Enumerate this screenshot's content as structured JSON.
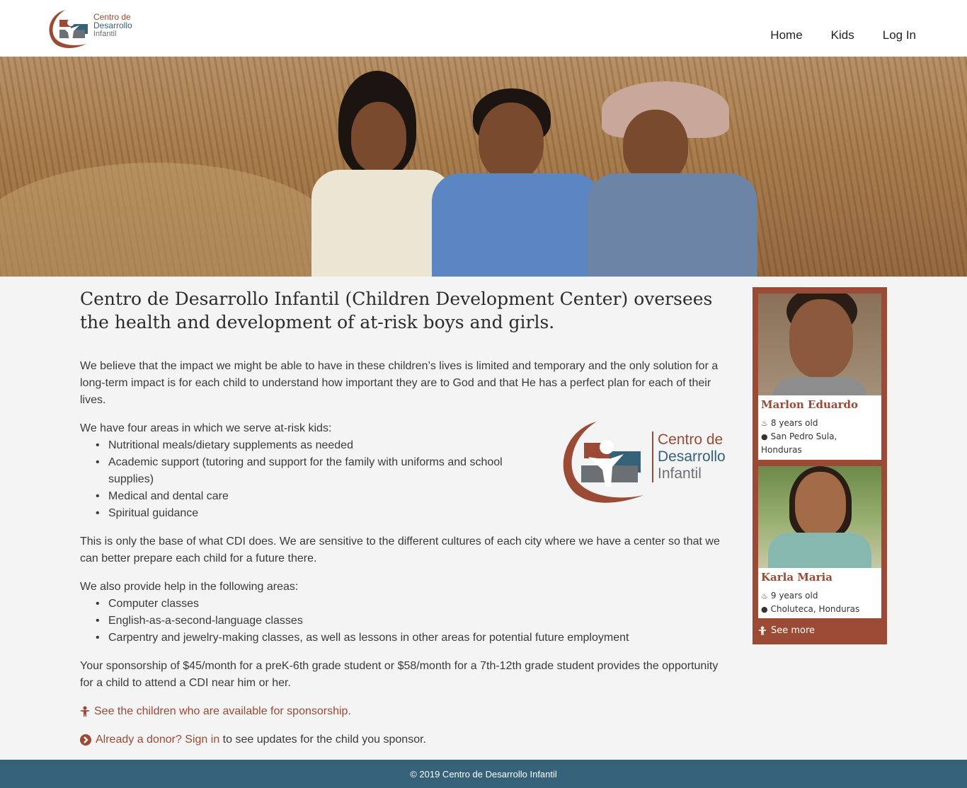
{
  "header": {
    "logo": {
      "line1": "Centro de",
      "line2": "Desarrollo",
      "line3": "Infantil"
    },
    "nav": [
      {
        "label": "Home"
      },
      {
        "label": "Kids"
      },
      {
        "label": "Log In"
      }
    ]
  },
  "hero": {
    "icon": "hero-photo-three-children"
  },
  "main": {
    "heading": "Centro de Desarrollo Infantil (Children Development Center) oversees the health and development of at-risk boys and girls.",
    "p1": "We believe that the impact we might be able to have in these children’s lives is limited and temporary and the only solution for a long-term impact is for each child to understand how important they are to God and that He has a perfect plan for each of their lives.",
    "p2": "We have four areas in which we serve at-risk kids:",
    "areas": [
      "Nutritional meals/dietary supplements as needed",
      "Academic support (tutoring and support for the family with uniforms and school supplies)",
      "Medical and dental care",
      "Spiritual guidance"
    ],
    "p3": "This is only the base of what CDI does. We are sensitive to the different cultures of each city where we have a center so that we can better prepare each child for a future there.",
    "p4": "We also provide help in the following areas:",
    "extra_areas": [
      "Computer classes",
      "English-as-a-second-language classes",
      "Carpentry and jewelry-making classes, as well as lessons in other areas for potential future employment"
    ],
    "p5": "Your sponsorship of $45/month for a preK-6th grade student or $58/month for a 7th-12th grade student provides the opportunity for a child to attend a CDI near him or her.",
    "link_children": "See the children who are available for sponsorship.",
    "link_signin": "Already a donor? Sign in",
    "signin_suffix": " to see updates for the child you sponsor.",
    "big_logo": {
      "line1": "Centro de",
      "line2": "Desarrollo",
      "line3": "Infantil"
    }
  },
  "sidebar": {
    "kids": [
      {
        "name": "Marlon Eduardo",
        "age": "8 years old",
        "location": "San Pedro Sula, Honduras"
      },
      {
        "name": "Karla Maria",
        "age": "9 years old",
        "location": "Choluteca, Honduras"
      }
    ],
    "see_more": "See more"
  },
  "footer": {
    "text": "© 2019 Centro de Desarrollo Infantil"
  },
  "colors": {
    "brand_red": "#9b4a35",
    "brand_blue": "#356179",
    "brand_gray": "#6b7075"
  }
}
